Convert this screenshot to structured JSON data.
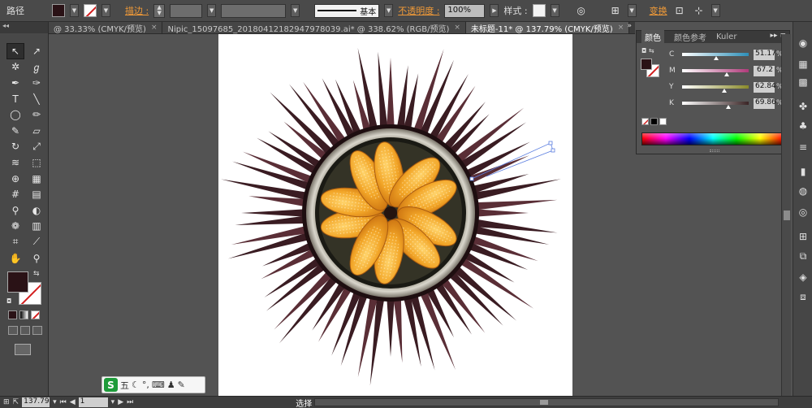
{
  "control_bar": {
    "object_type": "路径",
    "stroke_label": "描边 :",
    "stroke_profile": "基本",
    "opacity_label": "不透明度 :",
    "opacity_value": "100%",
    "style_label": "样式 :",
    "transform_label": "变换"
  },
  "tabs": [
    {
      "label": "@ 33.33% (CMYK/预览)",
      "close": "×"
    },
    {
      "label": "Nipic_15097685_20180412182947978039.ai* @ 338.62% (RGB/预览)",
      "close": "×"
    },
    {
      "label": "未标题-11* @ 137.79% (CMYK/预览)",
      "close": "×",
      "active": true
    }
  ],
  "tab_arrows": "»",
  "color_panel": {
    "tabs": [
      "颜色",
      "颜色参考",
      "Kuler"
    ],
    "collapse": "▸▸",
    "menu": "≡",
    "channels": [
      {
        "label": "C",
        "value": "51.17",
        "pct": "%",
        "fraction": 0.51,
        "color": "#2d8fb8"
      },
      {
        "label": "M",
        "value": "67.2",
        "pct": "%",
        "fraction": 0.67,
        "color": "#b03a7a"
      },
      {
        "label": "Y",
        "value": "62.84",
        "pct": "%",
        "fraction": 0.63,
        "color": "#8a8a2a"
      },
      {
        "label": "K",
        "value": "69.86",
        "pct": "%",
        "fraction": 0.7,
        "color": "#3a2526"
      }
    ],
    "fill_color": "#2a1216"
  },
  "status": {
    "zoom": "137.79",
    "page": "1",
    "mode": "选择"
  },
  "ime": {
    "logo": "S",
    "wubi": "五",
    "moon": "☾",
    "punct": "°,",
    "keyboard": "⌨",
    "person": "♟",
    "tools": "✎"
  },
  "colors": {
    "urchin_spine": "#3a1c22",
    "shell_rim": "#b5b0a4",
    "gonad": "#f2a527",
    "accent_link": "#f09a38"
  }
}
